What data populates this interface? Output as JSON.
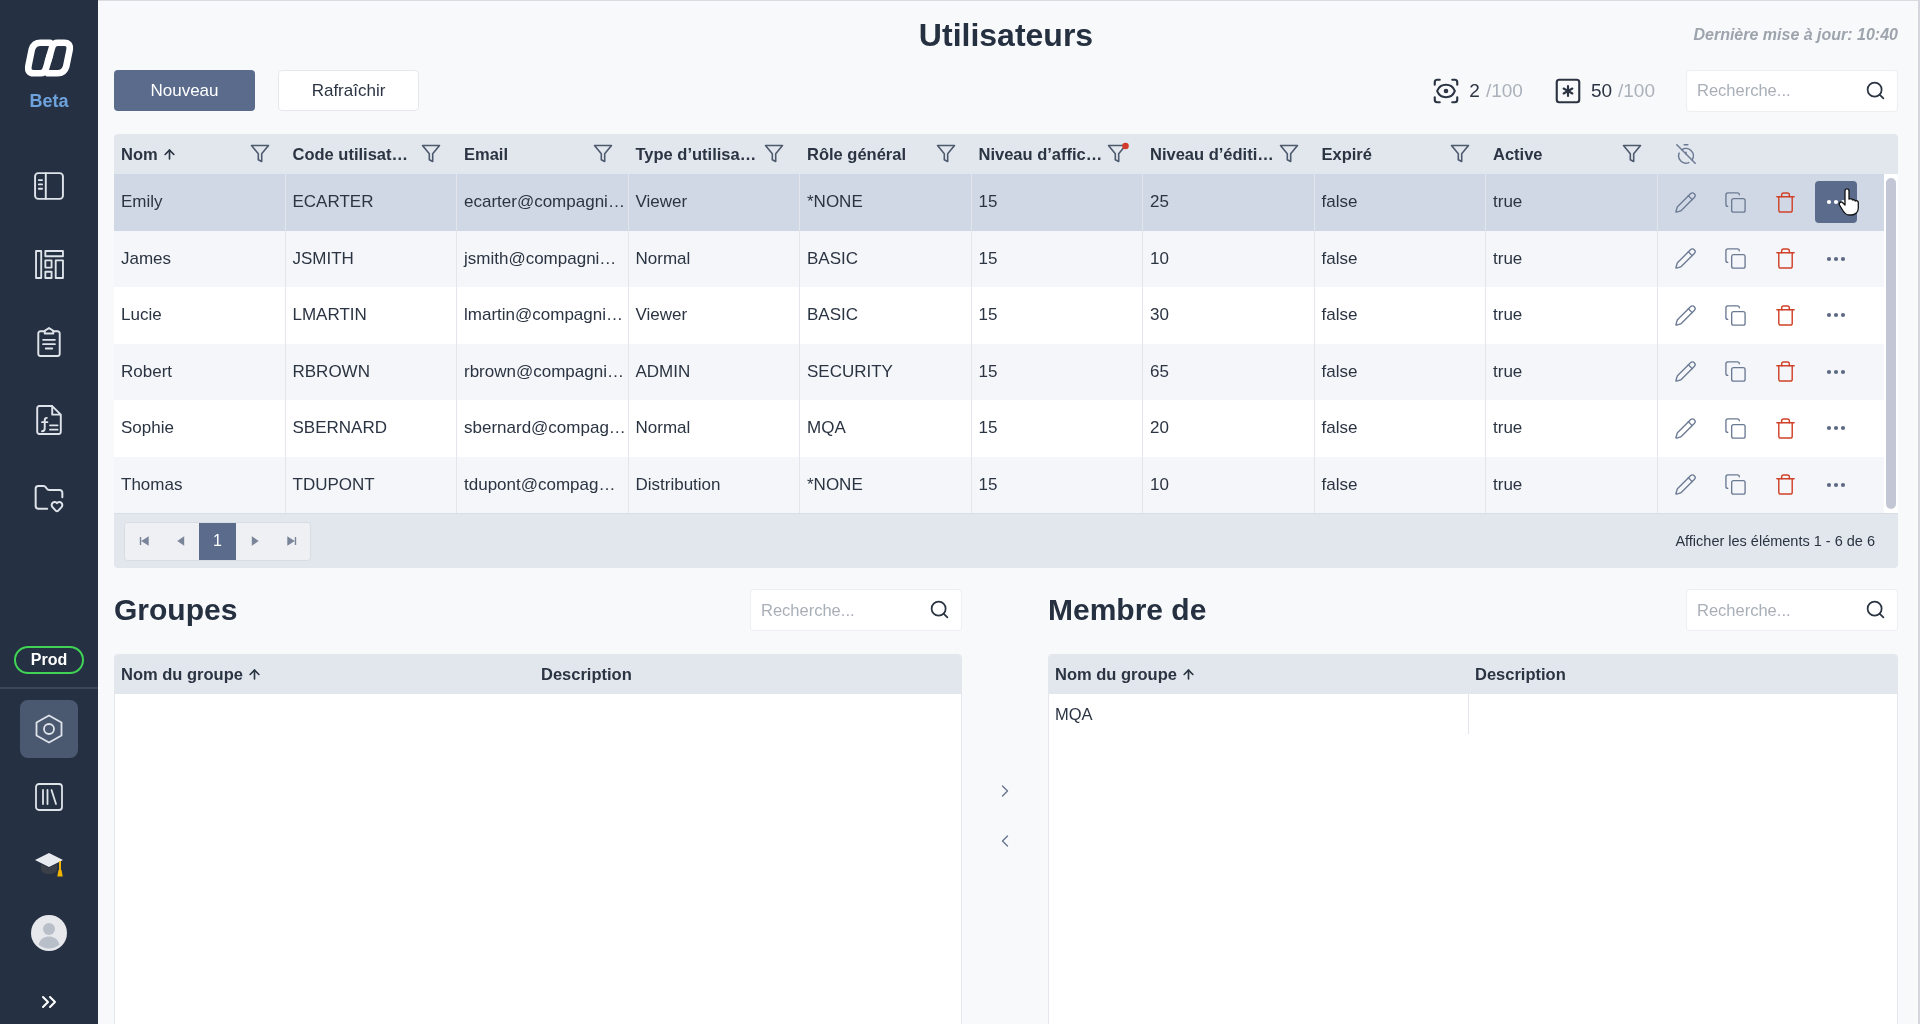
{
  "sidebar": {
    "logo_caption": "Beta",
    "top_items": [
      {
        "selected": false
      },
      {
        "selected": false
      },
      {
        "selected": false
      },
      {
        "selected": false
      },
      {
        "selected": false
      }
    ],
    "environment": "Prod",
    "bottom_items": [
      {
        "selected": true
      },
      {
        "selected": false
      },
      {
        "selected": false
      }
    ]
  },
  "header": {
    "title": "Utilisateurs",
    "last_update": "Dernière mise à jour: 10:40"
  },
  "toolbar": {
    "buttons": [
      {
        "label": "Nouveau",
        "kind": "primary"
      },
      {
        "label": "Rafraîchir",
        "kind": "secondary"
      }
    ],
    "counters": [
      {
        "value": "2",
        "limit": "/100"
      },
      {
        "value": "50",
        "limit": "/100"
      }
    ],
    "search": {
      "placeholder": "Recherche..."
    }
  },
  "users_table": {
    "columns": [
      {
        "label": "Nom",
        "sorted": true,
        "filtered": false
      },
      {
        "label": "Code utilisat…",
        "sorted": false,
        "filtered": false
      },
      {
        "label": "Email",
        "sorted": false,
        "filtered": false
      },
      {
        "label": "Type d’utilisa…",
        "sorted": false,
        "filtered": false
      },
      {
        "label": "Rôle général",
        "sorted": false,
        "filtered": false
      },
      {
        "label": "Niveau d’affic…",
        "sorted": false,
        "filtered": true
      },
      {
        "label": "Niveau d’éditi…",
        "sorted": false,
        "filtered": false
      },
      {
        "label": "Expiré",
        "sorted": false,
        "filtered": false
      },
      {
        "label": "Active",
        "sorted": false,
        "filtered": false
      }
    ],
    "rows": [
      {
        "cells": [
          "Emily",
          "ECARTER",
          "ecarter@compagni…",
          "Viewer",
          "*NONE",
          "15",
          "25",
          "false",
          "true"
        ],
        "selected": true,
        "actions_hovered": true
      },
      {
        "cells": [
          "James",
          "JSMITH",
          "jsmith@compagni…",
          "Normal",
          "BASIC",
          "15",
          "10",
          "false",
          "true"
        ],
        "selected": false,
        "actions_hovered": false
      },
      {
        "cells": [
          "Lucie",
          "LMARTIN",
          "lmartin@compagni…",
          "Viewer",
          "BASIC",
          "15",
          "30",
          "false",
          "true"
        ],
        "selected": false,
        "actions_hovered": false
      },
      {
        "cells": [
          "Robert",
          "RBROWN",
          "rbrown@compagni…",
          "ADMIN",
          "SECURITY",
          "15",
          "65",
          "false",
          "true"
        ],
        "selected": false,
        "actions_hovered": false
      },
      {
        "cells": [
          "Sophie",
          "SBERNARD",
          "sbernard@compag…",
          "Normal",
          "MQA",
          "15",
          "20",
          "false",
          "true"
        ],
        "selected": false,
        "actions_hovered": false
      },
      {
        "cells": [
          "Thomas",
          "TDUPONT",
          "tdupont@compag…",
          "Distribution",
          "*NONE",
          "15",
          "10",
          "false",
          "true"
        ],
        "selected": false,
        "actions_hovered": false
      }
    ],
    "pagination": {
      "pages": [
        {
          "label": "1",
          "selected": true
        }
      ],
      "summary": "Afficher les éléments 1 - 6 de 6"
    }
  },
  "groups_panel": {
    "title": "Groupes",
    "search": {
      "placeholder": "Recherche..."
    },
    "columns": [
      {
        "label": "Nom du groupe",
        "sorted": true
      },
      {
        "label": "Description",
        "sorted": false
      }
    ]
  },
  "member_panel": {
    "title": "Membre de",
    "search": {
      "placeholder": "Recherche..."
    },
    "columns": [
      {
        "label": "Nom du groupe",
        "sorted": true
      },
      {
        "label": "Description",
        "sorted": false
      }
    ],
    "rows": [
      {
        "group_name": "MQA"
      }
    ]
  }
}
